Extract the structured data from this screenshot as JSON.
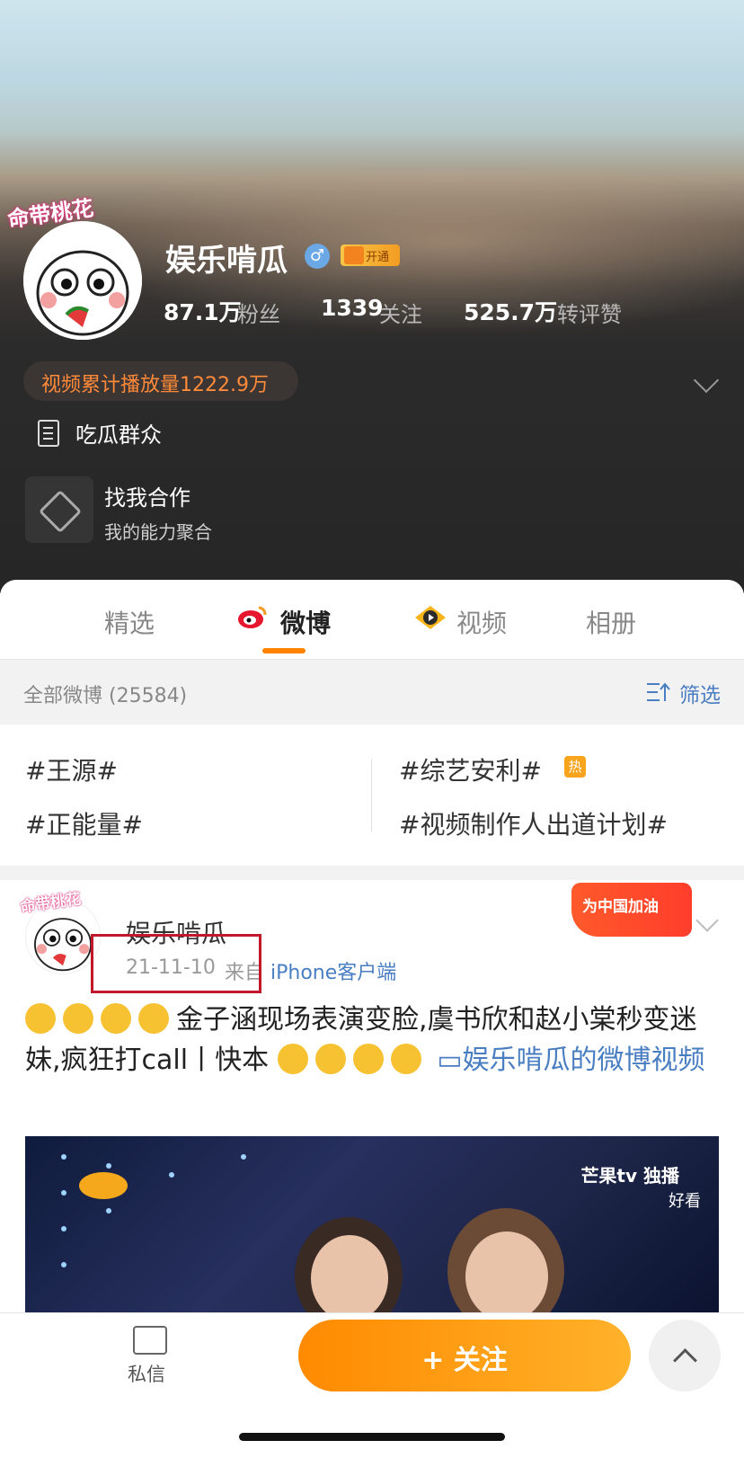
{
  "profile": {
    "name": "娱乐啃瓜",
    "gender_symbol": "♂",
    "vip_label": "开通",
    "avatar_badge_text": "命带桃花",
    "stats": [
      {
        "value": "87.1万",
        "label": "粉丝"
      },
      {
        "value": "1339",
        "label": "关注"
      },
      {
        "value": "525.7万",
        "label": "转评赞"
      }
    ],
    "play_count": "视频累计播放量1222.9万",
    "intro": "吃瓜群众",
    "coop_title": "找我合作",
    "coop_sub": "我的能力聚合"
  },
  "tabs": [
    {
      "label": "精选",
      "active": false
    },
    {
      "label": "微博",
      "active": true
    },
    {
      "label": "视频",
      "active": false
    },
    {
      "label": "相册",
      "active": false
    }
  ],
  "filter": {
    "count_label": "全部微博 (25584)",
    "filter_label": "筛选"
  },
  "topics": {
    "left": [
      "#王源#",
      "#正能量#"
    ],
    "right": [
      "#综艺安利#",
      "#视频制作人出道计划#"
    ],
    "hot_badge": "热"
  },
  "post": {
    "author": "娱乐啃瓜",
    "time": "21-11-10",
    "source_prefix": "来自",
    "source": "iPhone客户端",
    "badge_text": "为中国加油",
    "text_main": "金子涵现场表演变脸,虞书欣和赵小棠秒变迷妹,疯狂打call丨快本",
    "video_link": "娱乐啃瓜的微博视频",
    "thumb_watermark": "芒果tv 独播",
    "thumb_watermark2": "好看"
  },
  "bottom": {
    "message_label": "私信",
    "follow_label": "+ 关注"
  },
  "colors": {
    "accent": "#ff8200",
    "link": "#4a7ec2",
    "highlight_box": "#c3172b"
  }
}
